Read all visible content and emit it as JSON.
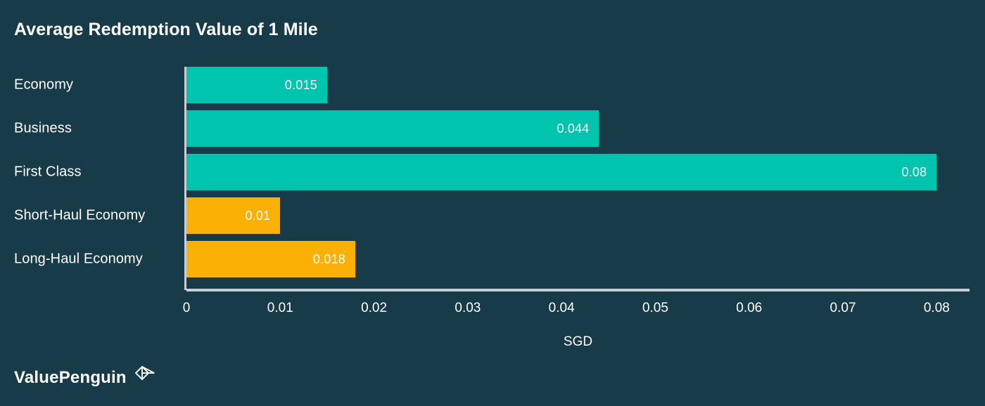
{
  "chart_data": {
    "type": "bar",
    "orientation": "horizontal",
    "title": "Average Redemption Value of 1 Mile",
    "categories": [
      "Economy",
      "Business",
      "First Class",
      "Short-Haul Economy",
      "Long-Haul Economy"
    ],
    "values": [
      0.015,
      0.044,
      0.08,
      0.01,
      0.018
    ],
    "value_labels": [
      "0.015",
      "0.044",
      "0.08",
      "0.01",
      "0.018"
    ],
    "bar_colors": [
      "#00c4ae",
      "#00c4ae",
      "#00c4ae",
      "#fab005",
      "#fab005"
    ],
    "xlabel": "SGD",
    "ylabel": "",
    "xlim": [
      0,
      0.0835
    ],
    "xticks": [
      0,
      0.01,
      0.02,
      0.03,
      0.04,
      0.05,
      0.06,
      0.07,
      0.08
    ],
    "xtick_labels": [
      "0",
      "0.01",
      "0.02",
      "0.03",
      "0.04",
      "0.05",
      "0.06",
      "0.07",
      "0.08"
    ],
    "grid": false,
    "legend": "none",
    "background_color": "#173b49",
    "axis_color": "#c9ced2",
    "text_color": "#ffffff"
  },
  "branding": {
    "name": "ValuePenguin",
    "logo_icon": "diamond-logo-icon"
  }
}
